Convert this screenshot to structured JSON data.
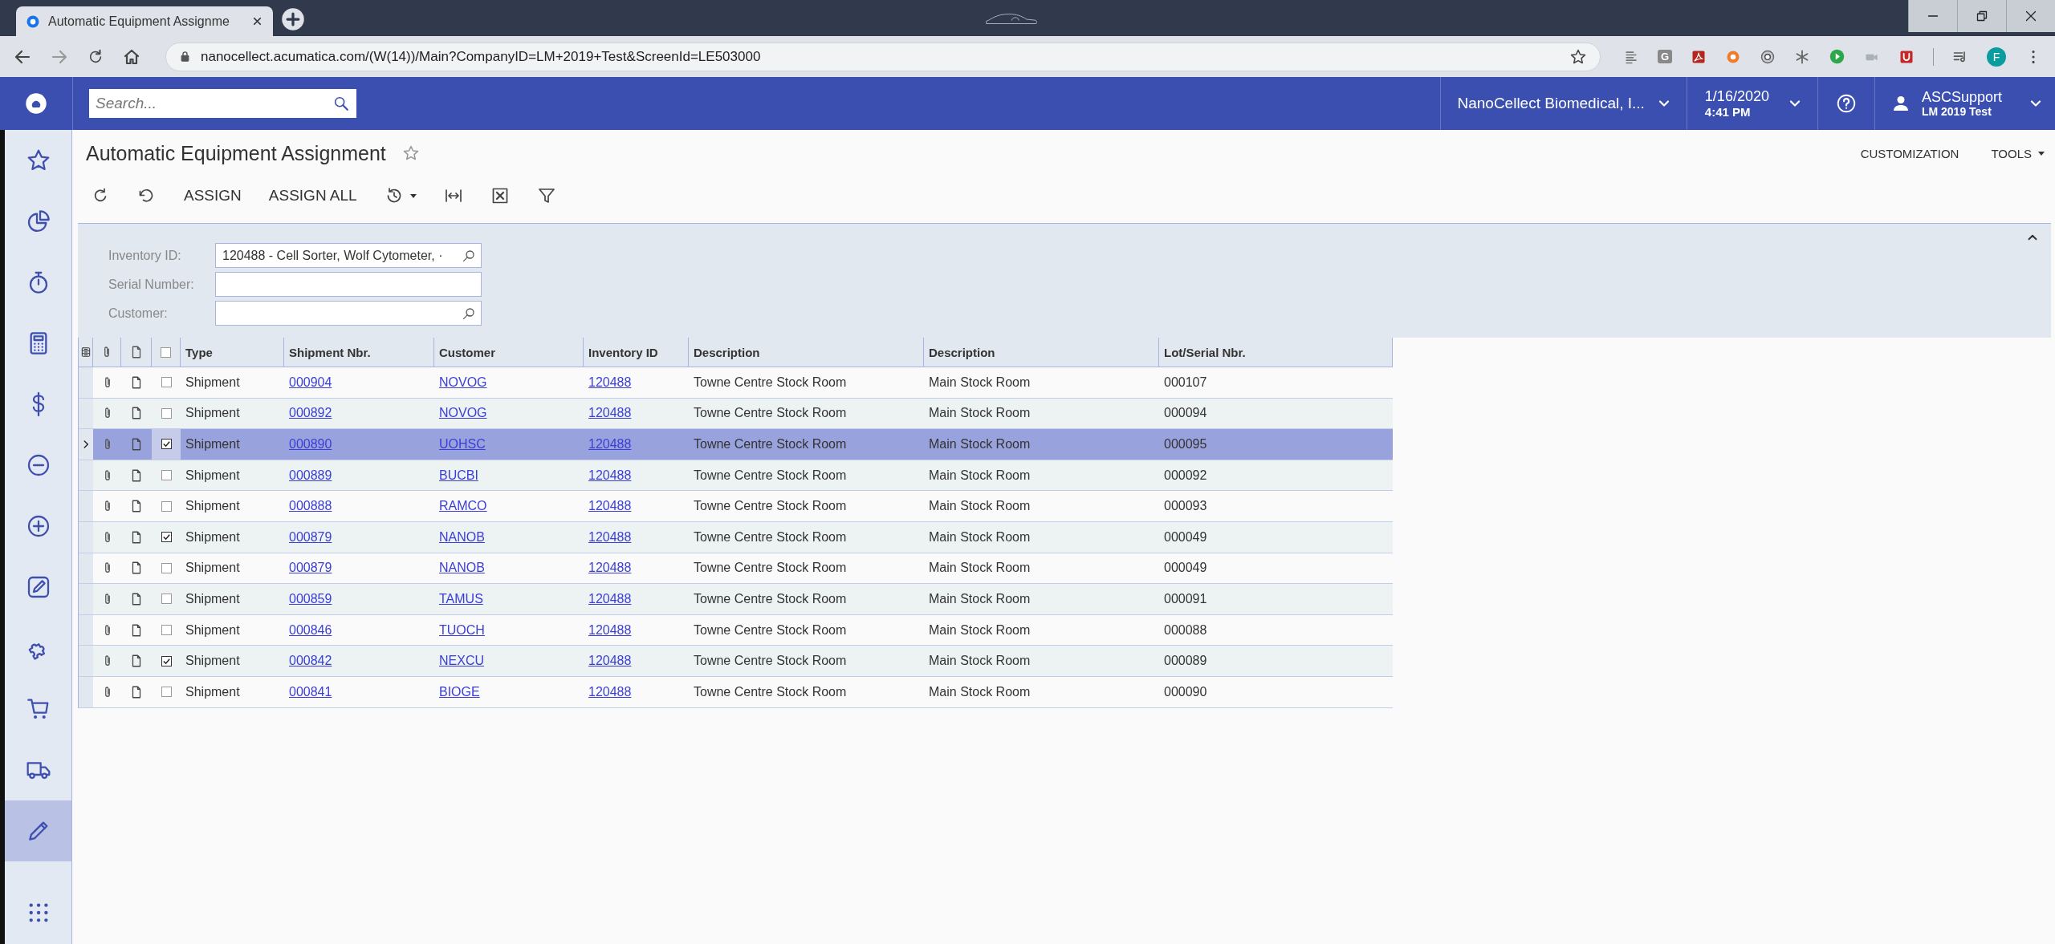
{
  "browser": {
    "tab_title": "Automatic Equipment Assignme",
    "url": "nanocellect.acumatica.com/(W(14))/Main?CompanyID=LM+2019+Test&ScreenId=LE503000",
    "extension_label": "G",
    "profile_initial": "F"
  },
  "app_header": {
    "search_placeholder": "Search...",
    "company": "NanoCellect Biomedical, I...",
    "date": "1/16/2020",
    "time": "4:41 PM",
    "user": "ASCSupport",
    "tenant": "LM 2019 Test"
  },
  "sidebar": {
    "items": [
      {
        "kind": "star",
        "selected": false
      },
      {
        "kind": "pie",
        "selected": false
      },
      {
        "kind": "timer",
        "selected": false
      },
      {
        "kind": "calculator",
        "selected": false
      },
      {
        "kind": "dollar",
        "selected": false
      },
      {
        "kind": "minus",
        "selected": false
      },
      {
        "kind": "plus",
        "selected": false
      },
      {
        "kind": "edit",
        "selected": false
      },
      {
        "kind": "puzzle",
        "selected": false
      },
      {
        "kind": "cart",
        "selected": false
      },
      {
        "kind": "truck",
        "selected": false
      },
      {
        "kind": "pencil",
        "selected": true
      },
      {
        "kind": "grid",
        "selected": false
      }
    ]
  },
  "page": {
    "title": "Automatic Equipment Assignment",
    "actions": [
      {
        "label": "CUSTOMIZATION",
        "dropdown": false
      },
      {
        "label": "TOOLS",
        "dropdown": true
      }
    ],
    "toolbar": [
      {
        "kind": "refresh"
      },
      {
        "kind": "undo"
      },
      {
        "kind": "text",
        "label": "ASSIGN"
      },
      {
        "kind": "text",
        "label": "ASSIGN ALL"
      },
      {
        "kind": "history"
      },
      {
        "kind": "fit"
      },
      {
        "kind": "excel"
      },
      {
        "kind": "filter"
      }
    ],
    "filters": [
      {
        "label": "Inventory ID:",
        "value": "120488 - Cell Sorter, Wolf Cytometer, ·",
        "lookup": true
      },
      {
        "label": "Serial Number:",
        "lookup": false
      },
      {
        "label": "Customer:",
        "lookup": true
      }
    ]
  },
  "table": {
    "select_all_checked": false,
    "columns": [
      "Type",
      "Shipment Nbr.",
      "Customer",
      "Inventory ID",
      "Description",
      "Description",
      "Lot/Serial Nbr."
    ],
    "rows": [
      {
        "type": "Shipment",
        "shipment": "000904",
        "customer": "NOVOG",
        "inventory": "120488",
        "description": "Towne Centre Stock Room",
        "description_2": "Main Stock Room",
        "lot_serial": "000107",
        "checked": false,
        "selected": false
      },
      {
        "type": "Shipment",
        "shipment": "000892",
        "customer": "NOVOG",
        "inventory": "120488",
        "description": "Towne Centre Stock Room",
        "description_2": "Main Stock Room",
        "lot_serial": "000094",
        "checked": false,
        "selected": false
      },
      {
        "type": "Shipment",
        "shipment": "000890",
        "customer": "UOHSC",
        "inventory": "120488",
        "description": "Towne Centre Stock Room",
        "description_2": "Main Stock Room",
        "lot_serial": "000095",
        "checked": true,
        "selected": true
      },
      {
        "type": "Shipment",
        "shipment": "000889",
        "customer": "BUCBI",
        "inventory": "120488",
        "description": "Towne Centre Stock Room",
        "description_2": "Main Stock Room",
        "lot_serial": "000092",
        "checked": false,
        "selected": false
      },
      {
        "type": "Shipment",
        "shipment": "000888",
        "customer": "RAMCO",
        "inventory": "120488",
        "description": "Towne Centre Stock Room",
        "description_2": "Main Stock Room",
        "lot_serial": "000093",
        "checked": false,
        "selected": false
      },
      {
        "type": "Shipment",
        "shipment": "000879",
        "customer": "NANOB",
        "inventory": "120488",
        "description": "Towne Centre Stock Room",
        "description_2": "Main Stock Room",
        "lot_serial": "000049",
        "checked": true,
        "selected": false
      },
      {
        "type": "Shipment",
        "shipment": "000879",
        "customer": "NANOB",
        "inventory": "120488",
        "description": "Towne Centre Stock Room",
        "description_2": "Main Stock Room",
        "lot_serial": "000049",
        "checked": false,
        "selected": false
      },
      {
        "type": "Shipment",
        "shipment": "000859",
        "customer": "TAMUS",
        "inventory": "120488",
        "description": "Towne Centre Stock Room",
        "description_2": "Main Stock Room",
        "lot_serial": "000091",
        "checked": false,
        "selected": false
      },
      {
        "type": "Shipment",
        "shipment": "000846",
        "customer": "TUOCH",
        "inventory": "120488",
        "description": "Towne Centre Stock Room",
        "description_2": "Main Stock Room",
        "lot_serial": "000088",
        "checked": false,
        "selected": false
      },
      {
        "type": "Shipment",
        "shipment": "000842",
        "customer": "NEXCU",
        "inventory": "120488",
        "description": "Towne Centre Stock Room",
        "description_2": "Main Stock Room",
        "lot_serial": "000089",
        "checked": true,
        "selected": false
      },
      {
        "type": "Shipment",
        "shipment": "000841",
        "customer": "BIOGE",
        "inventory": "120488",
        "description": "Towne Centre Stock Room",
        "description_2": "Main Stock Room",
        "lot_serial": "000090",
        "checked": false,
        "selected": false
      }
    ]
  }
}
